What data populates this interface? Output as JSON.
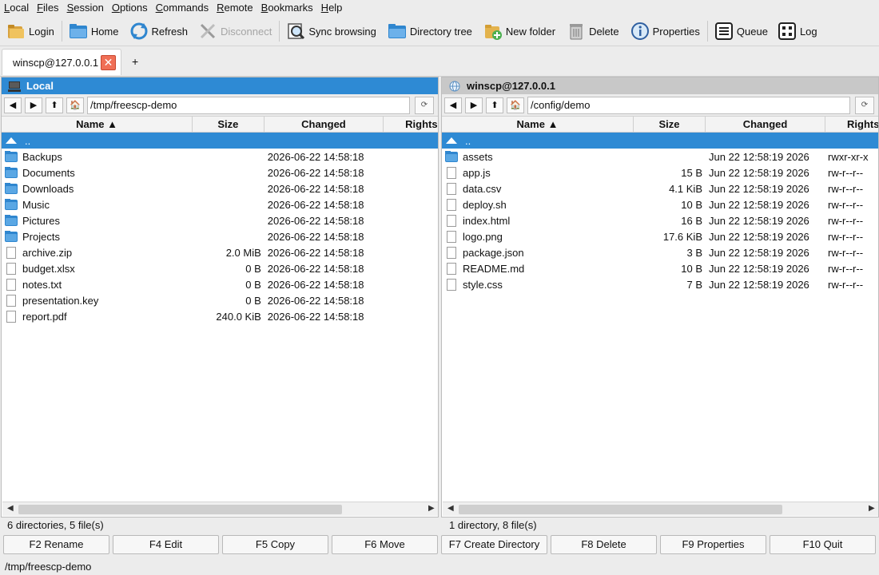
{
  "menu": [
    {
      "label": "Local",
      "u": "L"
    },
    {
      "label": "Files",
      "u": "F"
    },
    {
      "label": "Session",
      "u": "S"
    },
    {
      "label": "Options",
      "u": "O"
    },
    {
      "label": "Commands",
      "u": "C"
    },
    {
      "label": "Remote",
      "u": "R"
    },
    {
      "label": "Bookmarks",
      "u": "B"
    },
    {
      "label": "Help",
      "u": "H"
    }
  ],
  "toolbar": {
    "login": "Login",
    "home": "Home",
    "refresh": "Refresh",
    "disconnect": "Disconnect",
    "sync": "Sync browsing",
    "dirtree": "Directory tree",
    "newfolder": "New folder",
    "delete": "Delete",
    "properties": "Properties",
    "queue": "Queue",
    "log": "Log"
  },
  "tabs": {
    "session": "winscp@127.0.0.1",
    "add": "+"
  },
  "left": {
    "title": "Local",
    "path": "/tmp/freescp-demo",
    "columns": {
      "name": "Name ▲",
      "size": "Size",
      "changed": "Changed",
      "rights": "Rights"
    },
    "rows": [
      {
        "type": "up",
        "name": "..",
        "size": "",
        "changed": "",
        "rights": ""
      },
      {
        "type": "dir",
        "name": "Backups",
        "size": "",
        "changed": "2026-06-22 14:58:18",
        "rights": ""
      },
      {
        "type": "dir",
        "name": "Documents",
        "size": "",
        "changed": "2026-06-22 14:58:18",
        "rights": ""
      },
      {
        "type": "dir",
        "name": "Downloads",
        "size": "",
        "changed": "2026-06-22 14:58:18",
        "rights": ""
      },
      {
        "type": "dir",
        "name": "Music",
        "size": "",
        "changed": "2026-06-22 14:58:18",
        "rights": ""
      },
      {
        "type": "dir",
        "name": "Pictures",
        "size": "",
        "changed": "2026-06-22 14:58:18",
        "rights": ""
      },
      {
        "type": "dir",
        "name": "Projects",
        "size": "",
        "changed": "2026-06-22 14:58:18",
        "rights": ""
      },
      {
        "type": "file",
        "name": "archive.zip",
        "size": "2.0 MiB",
        "changed": "2026-06-22 14:58:18",
        "rights": ""
      },
      {
        "type": "file",
        "name": "budget.xlsx",
        "size": "0 B",
        "changed": "2026-06-22 14:58:18",
        "rights": ""
      },
      {
        "type": "file",
        "name": "notes.txt",
        "size": "0 B",
        "changed": "2026-06-22 14:58:18",
        "rights": ""
      },
      {
        "type": "file",
        "name": "presentation.key",
        "size": "0 B",
        "changed": "2026-06-22 14:58:18",
        "rights": ""
      },
      {
        "type": "file",
        "name": "report.pdf",
        "size": "240.0 KiB",
        "changed": "2026-06-22 14:58:18",
        "rights": ""
      }
    ],
    "status": "6 directories, 5 file(s)"
  },
  "right": {
    "title": "winscp@127.0.0.1",
    "path": "/config/demo",
    "columns": {
      "name": "Name ▲",
      "size": "Size",
      "changed": "Changed",
      "rights": "Rights"
    },
    "rows": [
      {
        "type": "up",
        "name": "..",
        "size": "",
        "changed": "",
        "rights": ""
      },
      {
        "type": "dir",
        "name": "assets",
        "size": "",
        "changed": "Jun 22 12:58:19 2026",
        "rights": "rwxr-xr-x"
      },
      {
        "type": "file",
        "name": "app.js",
        "size": "15 B",
        "changed": "Jun 22 12:58:19 2026",
        "rights": "rw-r--r--"
      },
      {
        "type": "file",
        "name": "data.csv",
        "size": "4.1 KiB",
        "changed": "Jun 22 12:58:19 2026",
        "rights": "rw-r--r--"
      },
      {
        "type": "file",
        "name": "deploy.sh",
        "size": "10 B",
        "changed": "Jun 22 12:58:19 2026",
        "rights": "rw-r--r--"
      },
      {
        "type": "file",
        "name": "index.html",
        "size": "16 B",
        "changed": "Jun 22 12:58:19 2026",
        "rights": "rw-r--r--"
      },
      {
        "type": "file",
        "name": "logo.png",
        "size": "17.6 KiB",
        "changed": "Jun 22 12:58:19 2026",
        "rights": "rw-r--r--"
      },
      {
        "type": "file",
        "name": "package.json",
        "size": "3 B",
        "changed": "Jun 22 12:58:19 2026",
        "rights": "rw-r--r--"
      },
      {
        "type": "file",
        "name": "README.md",
        "size": "10 B",
        "changed": "Jun 22 12:58:19 2026",
        "rights": "rw-r--r--"
      },
      {
        "type": "file",
        "name": "style.css",
        "size": "7 B",
        "changed": "Jun 22 12:58:19 2026",
        "rights": "rw-r--r--"
      }
    ],
    "status": "1 directory, 8 file(s)"
  },
  "fkeys": [
    "F2 Rename",
    "F4 Edit",
    "F5 Copy",
    "F6 Move",
    "F7 Create Directory",
    "F8 Delete",
    "F9 Properties",
    "F10 Quit"
  ],
  "bottom_path": "/tmp/freescp-demo"
}
